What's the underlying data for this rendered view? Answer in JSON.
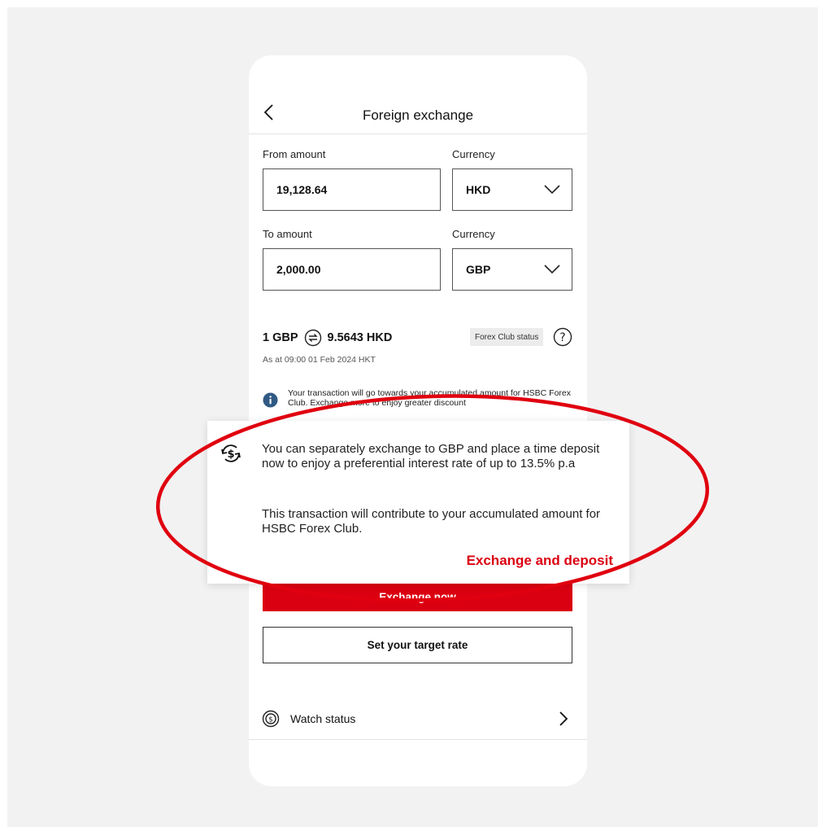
{
  "header": {
    "title": "Foreign exchange",
    "back_icon": "chevron-left-icon"
  },
  "form": {
    "from_amount_label": "From amount",
    "from_amount_value": "19,128.64",
    "from_currency_label": "Currency",
    "from_currency_value": "HKD",
    "to_amount_label": "To amount",
    "to_amount_value": "2,000.00",
    "to_currency_label": "Currency",
    "to_currency_value": "GBP"
  },
  "rate": {
    "from": "1 GBP",
    "to": "9.5643 HKD",
    "as_at": "As at 09:00 01 Feb 2024 HKT",
    "forex_badge": "Forex Club status"
  },
  "info": {
    "text": "Your transaction will go towards your accumulated amount for HSBC Forex Club. Exchange more to enjoy greater discount"
  },
  "popup": {
    "text1": "You can separately exchange to GBP and place a time deposit now to enjoy a preferential interest rate of up to 13.5% p.a",
    "text2": "This transaction will contribute to your accumulated amount for HSBC Forex Club.",
    "link": "Exchange and deposit",
    "icon": "currency-exchange-icon"
  },
  "actions": {
    "exchange_now": "Exchange now",
    "set_target_rate": "Set your target rate"
  },
  "watch": {
    "label": "Watch status"
  },
  "colors": {
    "brand_red": "#db0011",
    "annotation_red": "#e0000f",
    "page_bg": "#f2f2f2"
  }
}
